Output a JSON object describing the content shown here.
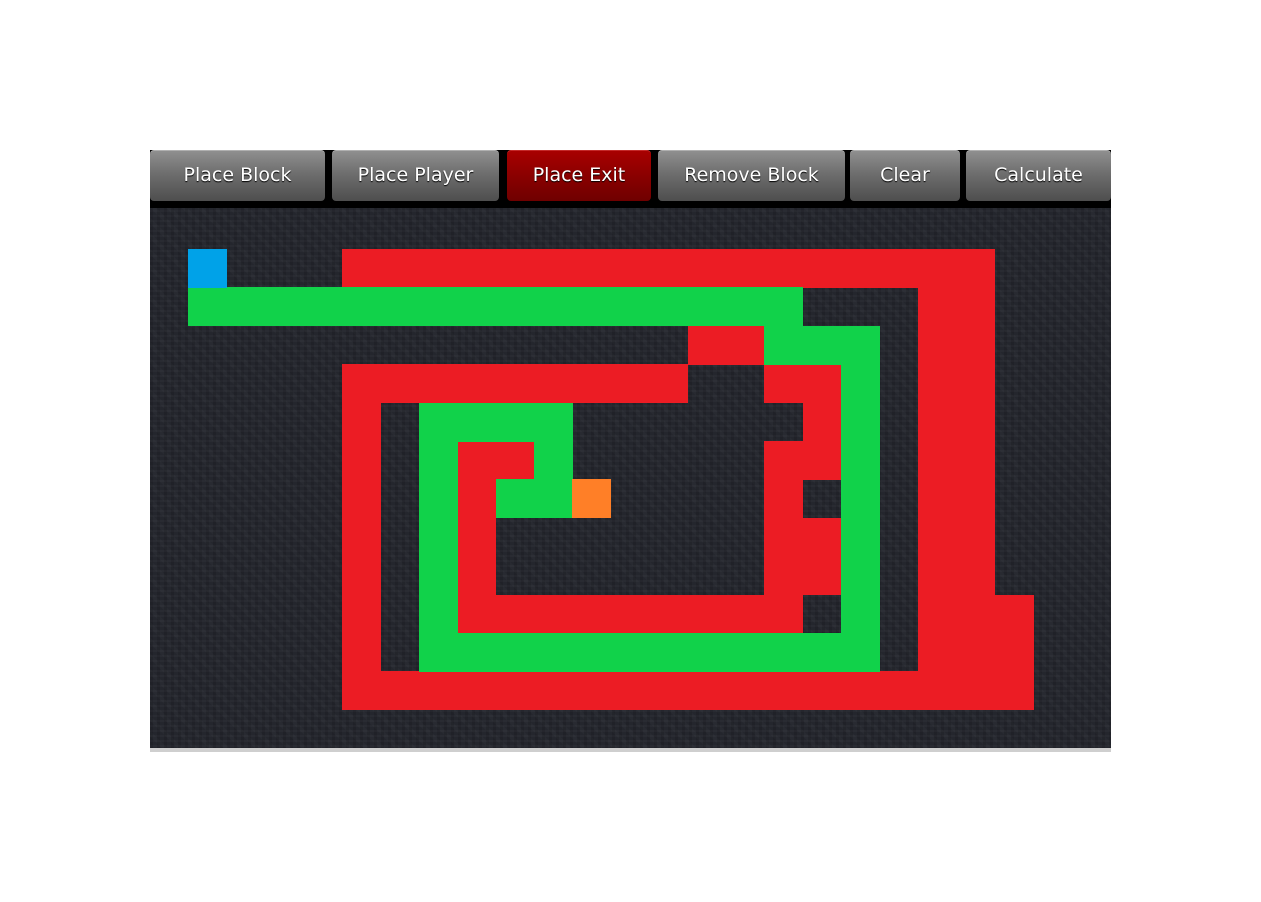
{
  "toolbar": {
    "buttons": [
      {
        "label": "Place Block",
        "active": false
      },
      {
        "label": "Place Player",
        "active": false
      },
      {
        "label": "Place Exit",
        "active": true
      },
      {
        "label": "Remove Block",
        "active": false
      },
      {
        "label": "Clear",
        "active": false
      },
      {
        "label": "Calculate",
        "active": false
      }
    ]
  },
  "colors": {
    "block": "#ec1c24",
    "path": "#11d24a",
    "player": "#00a2e8",
    "exit": "#ff7f27",
    "active_button": "#8a0000"
  },
  "grid": {
    "player": [
      1,
      1
    ],
    "exit": [
      11,
      7
    ],
    "blocks": [
      [
        5,
        1
      ],
      [
        6,
        1
      ],
      [
        7,
        1
      ],
      [
        8,
        1
      ],
      [
        9,
        1
      ],
      [
        10,
        1
      ],
      [
        11,
        1
      ],
      [
        12,
        1
      ],
      [
        13,
        1
      ],
      [
        14,
        1
      ],
      [
        15,
        1
      ],
      [
        16,
        1
      ],
      [
        17,
        1
      ],
      [
        18,
        1
      ],
      [
        19,
        1
      ],
      [
        20,
        1
      ],
      [
        21,
        1
      ],
      [
        20,
        2
      ],
      [
        21,
        2
      ],
      [
        14,
        3
      ],
      [
        15,
        3
      ],
      [
        20,
        3
      ],
      [
        21,
        3
      ],
      [
        5,
        4
      ],
      [
        6,
        4
      ],
      [
        7,
        4
      ],
      [
        8,
        4
      ],
      [
        9,
        4
      ],
      [
        10,
        4
      ],
      [
        11,
        4
      ],
      [
        12,
        4
      ],
      [
        13,
        4
      ],
      [
        16,
        4
      ],
      [
        17,
        4
      ],
      [
        20,
        4
      ],
      [
        21,
        4
      ],
      [
        5,
        5
      ],
      [
        17,
        5
      ],
      [
        20,
        5
      ],
      [
        21,
        5
      ],
      [
        5,
        6
      ],
      [
        8,
        6
      ],
      [
        9,
        6
      ],
      [
        16,
        6
      ],
      [
        17,
        6
      ],
      [
        20,
        6
      ],
      [
        21,
        6
      ],
      [
        5,
        7
      ],
      [
        8,
        7
      ],
      [
        16,
        7
      ],
      [
        20,
        7
      ],
      [
        21,
        7
      ],
      [
        5,
        8
      ],
      [
        8,
        8
      ],
      [
        16,
        8
      ],
      [
        17,
        8
      ],
      [
        20,
        8
      ],
      [
        21,
        8
      ],
      [
        5,
        9
      ],
      [
        8,
        9
      ],
      [
        16,
        9
      ],
      [
        17,
        9
      ],
      [
        20,
        9
      ],
      [
        21,
        9
      ],
      [
        5,
        10
      ],
      [
        8,
        10
      ],
      [
        9,
        10
      ],
      [
        10,
        10
      ],
      [
        11,
        10
      ],
      [
        12,
        10
      ],
      [
        13,
        10
      ],
      [
        14,
        10
      ],
      [
        15,
        10
      ],
      [
        16,
        10
      ],
      [
        20,
        10
      ],
      [
        21,
        10
      ],
      [
        22,
        10
      ],
      [
        5,
        11
      ],
      [
        20,
        11
      ],
      [
        21,
        11
      ],
      [
        22,
        11
      ],
      [
        5,
        12
      ],
      [
        6,
        12
      ],
      [
        7,
        12
      ],
      [
        8,
        12
      ],
      [
        9,
        12
      ],
      [
        10,
        12
      ],
      [
        11,
        12
      ],
      [
        12,
        12
      ],
      [
        13,
        12
      ],
      [
        14,
        12
      ],
      [
        15,
        12
      ],
      [
        16,
        12
      ],
      [
        17,
        12
      ],
      [
        18,
        12
      ],
      [
        19,
        12
      ],
      [
        20,
        12
      ],
      [
        21,
        12
      ],
      [
        22,
        12
      ]
    ],
    "path": [
      [
        1,
        2
      ],
      [
        2,
        2
      ],
      [
        3,
        2
      ],
      [
        4,
        2
      ],
      [
        5,
        2
      ],
      [
        6,
        2
      ],
      [
        7,
        2
      ],
      [
        8,
        2
      ],
      [
        9,
        2
      ],
      [
        10,
        2
      ],
      [
        11,
        2
      ],
      [
        12,
        2
      ],
      [
        13,
        2
      ],
      [
        14,
        2
      ],
      [
        15,
        2
      ],
      [
        16,
        2
      ],
      [
        16,
        3
      ],
      [
        17,
        3
      ],
      [
        18,
        3
      ],
      [
        18,
        4
      ],
      [
        18,
        5
      ],
      [
        18,
        6
      ],
      [
        18,
        7
      ],
      [
        18,
        8
      ],
      [
        18,
        9
      ],
      [
        18,
        10
      ],
      [
        7,
        5
      ],
      [
        8,
        5
      ],
      [
        9,
        5
      ],
      [
        10,
        5
      ],
      [
        7,
        6
      ],
      [
        10,
        6
      ],
      [
        7,
        7
      ],
      [
        9,
        7
      ],
      [
        10,
        7
      ],
      [
        7,
        8
      ],
      [
        7,
        9
      ],
      [
        7,
        10
      ],
      [
        7,
        11
      ],
      [
        8,
        11
      ],
      [
        9,
        11
      ],
      [
        10,
        11
      ],
      [
        11,
        11
      ],
      [
        12,
        11
      ],
      [
        13,
        11
      ],
      [
        14,
        11
      ],
      [
        15,
        11
      ],
      [
        16,
        11
      ],
      [
        17,
        11
      ],
      [
        18,
        11
      ]
    ]
  }
}
